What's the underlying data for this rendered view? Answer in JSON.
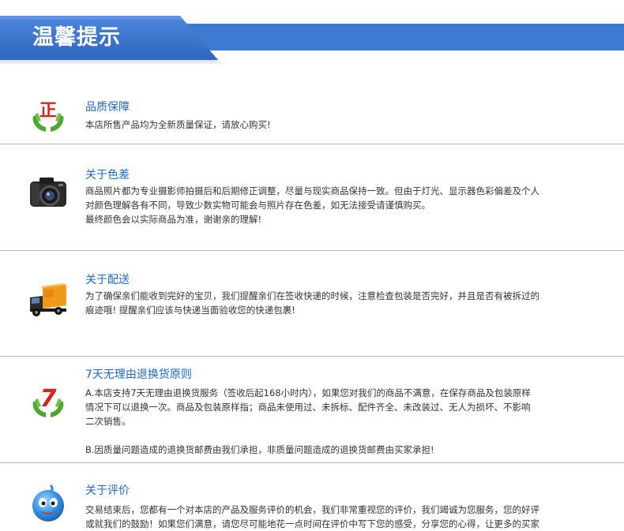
{
  "header": {
    "title": "温馨提示"
  },
  "sections": [
    {
      "icon": "quality-guarantee-icon",
      "title": "品质保障",
      "lines": [
        "本店所售产品均为全新质量保证，请放心购买!"
      ]
    },
    {
      "icon": "camera-icon",
      "title": "关于色差",
      "lines": [
        "商品照片都为专业摄影师拍摄后和后期修正调整，尽量与现实商品保持一致。但由于灯光、显示器色彩偏差及个人",
        "对颜色理解各有不同，导致少数实物可能会与照片存在色差，如无法接受请谨慎购买。",
        "最终颜色会以实际商品为准，谢谢亲的理解!"
      ]
    },
    {
      "icon": "delivery-truck-icon",
      "title": "关于配送",
      "lines": [
        "为了确保亲们能收到完好的宝贝，我们提醒亲们在签收快递的时候，注意检查包装是否完好，并且是否有被拆过的",
        "痕迹哦! 提醒亲们应该与快递当面验收您的快递包裹!"
      ]
    },
    {
      "icon": "seven-day-return-icon",
      "title": "7天无理由退换货原则",
      "lines": [
        "A.本店支持7天无理由退换货服务（签收后起168小时内），如果您对我们的商品不满意，在保存商品及包装原样",
        "情况下可以退换一次。商品及包装原样指；商品未使用过、未拆标、配件齐全、未改装过、无人为损坏、不影响",
        "二次销售。"
      ],
      "lines2": [
        "B.因质量问题造成的退换货邮费由我们承担，非质量问题造成的退换货邮费由买家承担!"
      ]
    },
    {
      "icon": "smiley-face-icon",
      "title": "关于评价",
      "lines": [
        "交易结束后，您都有一个对本店的产品及服务评价的机会，我们非常重视您的评价，我们竭诚为您服务，您的好评",
        "或就我们的鼓励！如果您们满意，请您尽可能地花一点时间在评价中写下您的感受，分享您的心得，让更多的买家"
      ]
    }
  ],
  "colors": {
    "banner_blue": "#3f7ad2",
    "title_blue": "#1a6ad6",
    "divider": "#b4b4b4"
  }
}
